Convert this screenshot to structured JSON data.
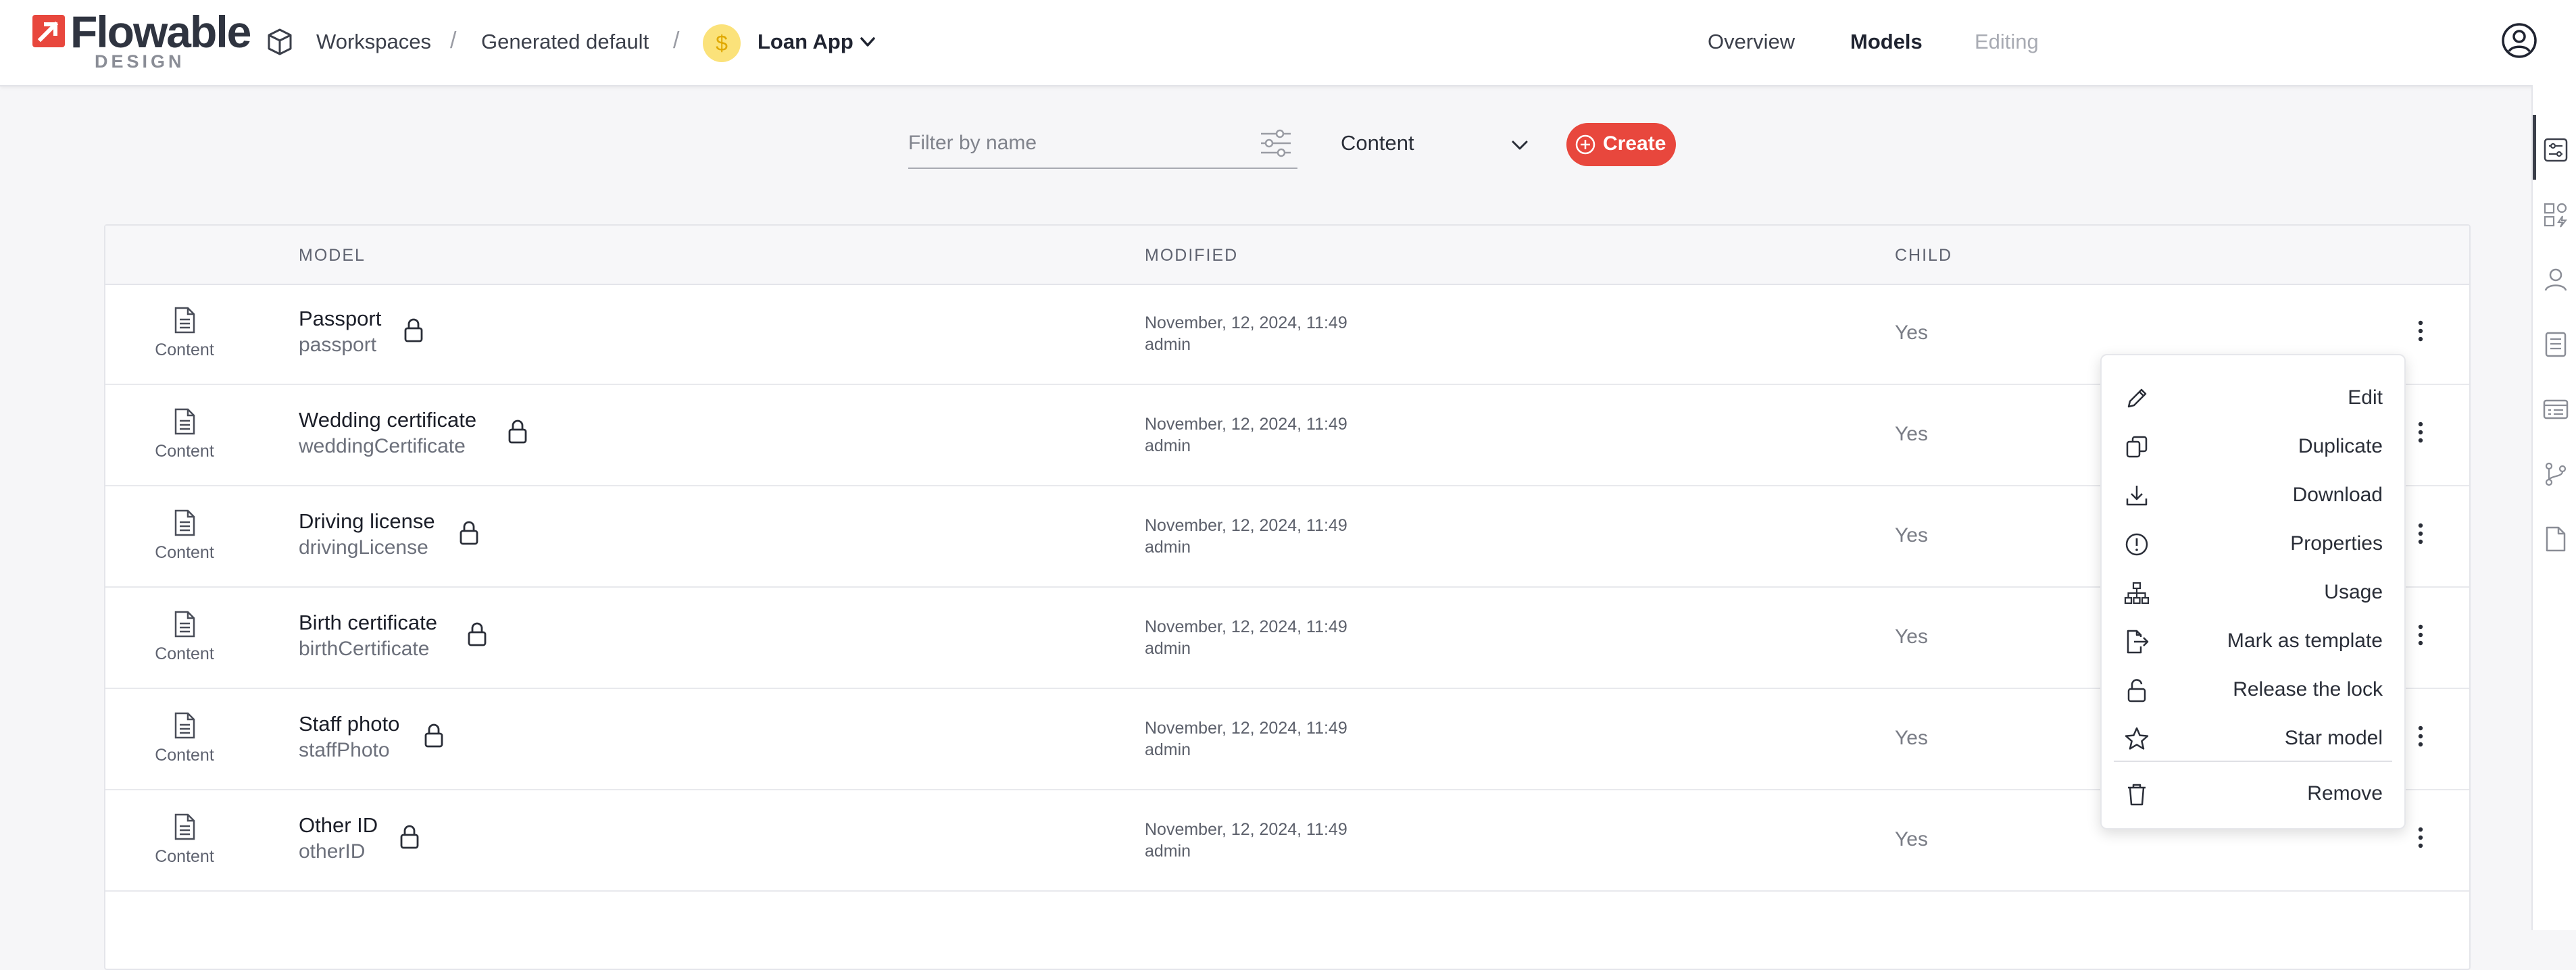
{
  "brand": {
    "logo_text": "Flowable",
    "logo_sub": "DESIGN",
    "accent": "#e8473d"
  },
  "breadcrumb": {
    "items": [
      "Workspaces",
      "Generated default"
    ],
    "separator": "/",
    "app_name": "Loan App",
    "app_icon": "dollar-coin-icon"
  },
  "nav": {
    "tabs": [
      "Overview",
      "Models",
      "Editing"
    ],
    "active": "Models"
  },
  "toolbar": {
    "filter_placeholder": "Filter by name",
    "type_select_value": "Content",
    "create_label": "Create"
  },
  "table": {
    "columns": [
      "MODEL",
      "MODIFIED",
      "CHILD"
    ],
    "rows": [
      {
        "type": "Content",
        "name": "Passport",
        "key": "passport",
        "modified": "November, 12, 2024, 11:49",
        "modified_by": "admin",
        "child": "Yes"
      },
      {
        "type": "Content",
        "name": "Wedding certificate",
        "key": "weddingCertificate",
        "modified": "November, 12, 2024, 11:49",
        "modified_by": "admin",
        "child": "Yes"
      },
      {
        "type": "Content",
        "name": "Driving license",
        "key": "drivingLicense",
        "modified": "November, 12, 2024, 11:49",
        "modified_by": "admin",
        "child": "Yes"
      },
      {
        "type": "Content",
        "name": "Birth certificate",
        "key": "birthCertificate",
        "modified": "November, 12, 2024, 11:49",
        "modified_by": "admin",
        "child": "Yes"
      },
      {
        "type": "Content",
        "name": "Staff photo",
        "key": "staffPhoto",
        "modified": "November, 12, 2024, 11:49",
        "modified_by": "admin",
        "child": "Yes"
      },
      {
        "type": "Content",
        "name": "Other ID",
        "key": "otherID",
        "modified": "November, 12, 2024, 11:49",
        "modified_by": "admin",
        "child": "Yes"
      }
    ]
  },
  "context_menu": {
    "items": [
      {
        "label": "Edit",
        "icon": "pencil-icon"
      },
      {
        "label": "Duplicate",
        "icon": "duplicate-icon"
      },
      {
        "label": "Download",
        "icon": "download-icon"
      },
      {
        "label": "Properties",
        "icon": "info-circle-icon"
      },
      {
        "label": "Usage",
        "icon": "hierarchy-icon"
      },
      {
        "label": "Mark as template",
        "icon": "file-export-icon"
      },
      {
        "label": "Release the lock",
        "icon": "unlock-icon"
      },
      {
        "label": "Star model",
        "icon": "star-icon"
      },
      {
        "label": "Remove",
        "icon": "trash-icon"
      }
    ]
  },
  "right_sidebar": {
    "icons": [
      "form-sliders-icon",
      "shapes-lightning-icon",
      "person-icon",
      "document-lines-icon",
      "card-list-icon",
      "branch-icon",
      "page-icon"
    ],
    "active_index": 0
  }
}
